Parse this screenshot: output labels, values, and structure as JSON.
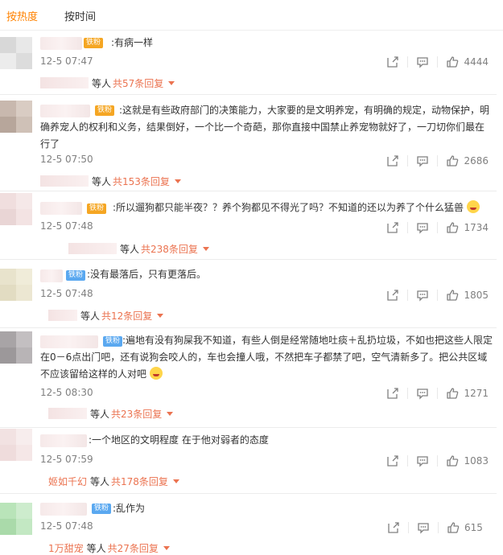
{
  "tabs": {
    "hot": "按热度",
    "time": "按时间"
  },
  "comments": [
    {
      "badge": "铁粉",
      "text": ":有病一样",
      "time": "12-5 07:47",
      "likes": "4444",
      "reply_prefix": "等人",
      "reply_link": "共57条回复"
    },
    {
      "badge": "铁粉",
      "text": ":这就是有些政府部门的决策能力，大家要的是文明养宠，有明确的规定，动物保护，明确养宠人的权利和义务，结果倒好，一个比一个奇葩，那你直接中国禁止养宠物就好了，一刀切你们最在行了",
      "time": "12-5 07:50",
      "likes": "2686",
      "reply_prefix": "等人",
      "reply_link": "共153条回复"
    },
    {
      "badge": "铁粉",
      "text": ":所以遛狗都只能半夜？？养个狗都见不得光了吗？不知道的还以为养了个什么猛兽",
      "time": "12-5 07:48",
      "likes": "1734",
      "reply_prefix": "等人",
      "reply_link": "共238条回复"
    },
    {
      "badge": "铁粉",
      "text": ":没有最落后，只有更落后。",
      "time": "12-5 07:48",
      "likes": "1805",
      "reply_prefix": "等人",
      "reply_link": "共12条回复"
    },
    {
      "badge": "铁粉",
      "text": ":遍地有没有狗屎我不知道，有些人倒是经常随地吐痰＋乱扔垃圾，不如也把这些人限定在0－6点出门吧，还有说狗会咬人的，车也会撞人哦，不然把车子都禁了吧，空气清新多了。把公共区域不应该留给这样的人对吧",
      "time": "12-5 08:30",
      "likes": "1271",
      "reply_prefix": "等人",
      "reply_link": "共23条回复"
    },
    {
      "badge": "",
      "text": ":一个地区的文明程度 在于他对弱者的态度",
      "time": "12-5 07:59",
      "likes": "1083",
      "reply_named": "姬如千幻",
      "reply_prefix": "等人",
      "reply_link": "共178条回复"
    },
    {
      "badge": "铁粉",
      "text": ":乱作为",
      "time": "12-5 07:48",
      "likes": "615",
      "reply_named": "1万甜宠",
      "reply_prefix": "等人",
      "reply_link": "共27条回复"
    }
  ],
  "colors": {
    "accent": "#ff8200",
    "link": "#eb7350",
    "gold_badge": "#f5a623",
    "blue_badge": "#5aa8f0"
  },
  "icons": [
    "share-icon",
    "comment-icon",
    "like-icon",
    "caret-down-icon",
    "crown-icon",
    "emoji-icon"
  ]
}
